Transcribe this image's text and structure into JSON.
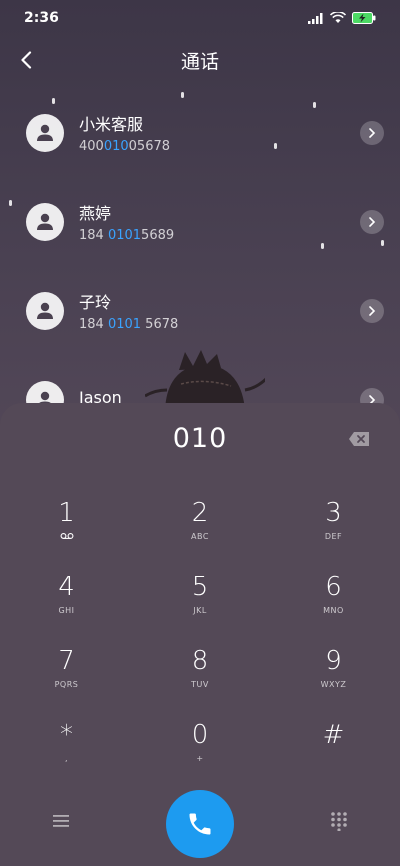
{
  "status": {
    "time": "2:36"
  },
  "header": {
    "title": "通话"
  },
  "contacts": [
    {
      "name": "小米客服",
      "num_pre": "400",
      "num_hl": "010",
      "num_post": "05678"
    },
    {
      "name": "燕婷",
      "num_pre": "184 ",
      "num_hl": "0101",
      "num_post": "5689"
    },
    {
      "name": "子玲",
      "num_pre": "184 ",
      "num_hl": "0101",
      "num_post": " 5678"
    },
    {
      "name": "Jason",
      "num_pre": "",
      "num_hl": "",
      "num_post": ""
    }
  ],
  "dialer": {
    "entered": "010",
    "keys": [
      {
        "digit": "1",
        "sub": ""
      },
      {
        "digit": "2",
        "sub": "ABC"
      },
      {
        "digit": "3",
        "sub": "DEF"
      },
      {
        "digit": "4",
        "sub": "GHI"
      },
      {
        "digit": "5",
        "sub": "JKL"
      },
      {
        "digit": "6",
        "sub": "MNO"
      },
      {
        "digit": "7",
        "sub": "PQRS"
      },
      {
        "digit": "8",
        "sub": "TUV"
      },
      {
        "digit": "9",
        "sub": "WXYZ"
      },
      {
        "digit": "*",
        "sub": ","
      },
      {
        "digit": "0",
        "sub": "+"
      },
      {
        "digit": "#",
        "sub": ""
      }
    ]
  },
  "icons": {
    "back": "back-arrow-icon",
    "detail": "chevron-right-icon",
    "delete": "backspace-icon",
    "call": "phone-icon",
    "menu": "menu-icon",
    "keypad": "dialpad-icon",
    "voicemail": "voicemail-icon"
  },
  "colors": {
    "accent": "#1d9bf0",
    "highlight": "#3aa3ff"
  }
}
